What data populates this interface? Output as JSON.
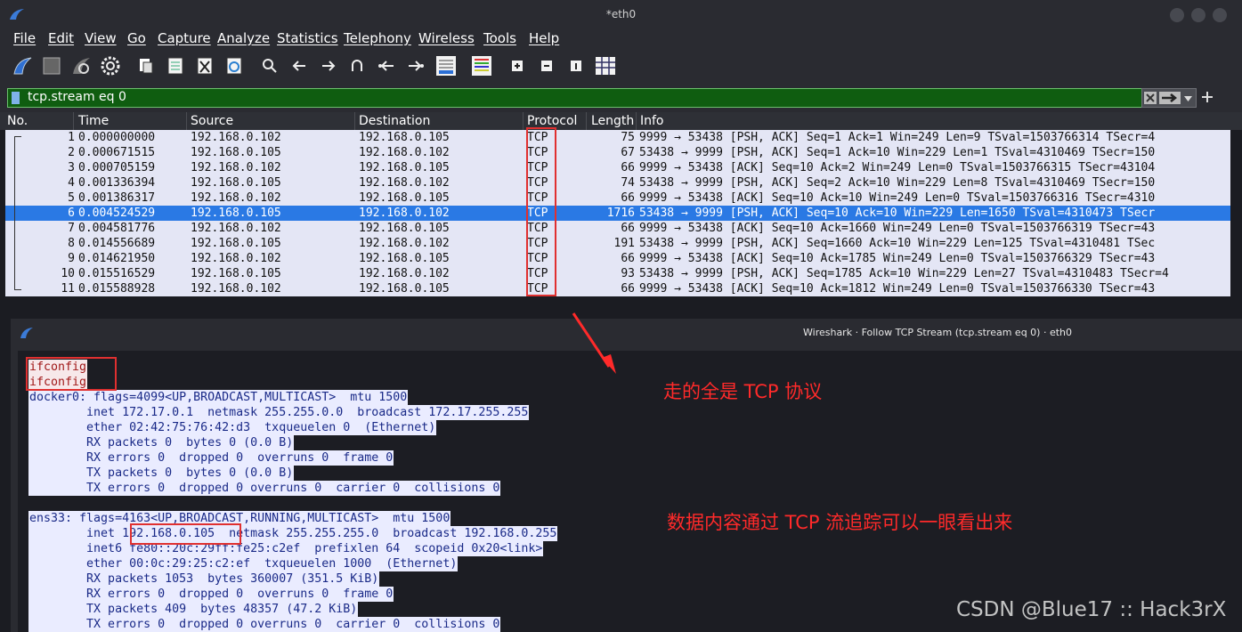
{
  "window": {
    "title": "*eth0"
  },
  "menu": [
    "File",
    "Edit",
    "View",
    "Go",
    "Capture",
    "Analyze",
    "Statistics",
    "Telephony",
    "Wireless",
    "Tools",
    "Help"
  ],
  "filter": {
    "value": "tcp.stream eq 0"
  },
  "columns": {
    "no": "No.",
    "time": "Time",
    "source": "Source",
    "destination": "Destination",
    "protocol": "Protocol",
    "length": "Length",
    "info": "Info"
  },
  "packets": [
    {
      "no": "1",
      "time": "0.000000000",
      "src": "192.168.0.102",
      "dst": "192.168.0.105",
      "proto": "TCP",
      "len": "75",
      "info": "9999 → 53438 [PSH, ACK] Seq=1 Ack=1 Win=249 Len=9 TSval=1503766314 TSecr=4"
    },
    {
      "no": "2",
      "time": "0.000671515",
      "src": "192.168.0.105",
      "dst": "192.168.0.102",
      "proto": "TCP",
      "len": "67",
      "info": "53438 → 9999 [PSH, ACK] Seq=1 Ack=10 Win=229 Len=1 TSval=4310469 TSecr=150"
    },
    {
      "no": "3",
      "time": "0.000705159",
      "src": "192.168.0.102",
      "dst": "192.168.0.105",
      "proto": "TCP",
      "len": "66",
      "info": "9999 → 53438 [ACK] Seq=10 Ack=2 Win=249 Len=0 TSval=1503766315 TSecr=43104"
    },
    {
      "no": "4",
      "time": "0.001336394",
      "src": "192.168.0.105",
      "dst": "192.168.0.102",
      "proto": "TCP",
      "len": "74",
      "info": "53438 → 9999 [PSH, ACK] Seq=2 Ack=10 Win=229 Len=8 TSval=4310469 TSecr=150"
    },
    {
      "no": "5",
      "time": "0.001386317",
      "src": "192.168.0.102",
      "dst": "192.168.0.105",
      "proto": "TCP",
      "len": "66",
      "info": "9999 → 53438 [ACK] Seq=10 Ack=10 Win=249 Len=0 TSval=1503766316 TSecr=4310"
    },
    {
      "no": "6",
      "time": "0.004524529",
      "src": "192.168.0.105",
      "dst": "192.168.0.102",
      "proto": "TCP",
      "len": "1716",
      "info": "53438 → 9999 [PSH, ACK] Seq=10 Ack=10 Win=229 Len=1650 TSval=4310473 TSecr"
    },
    {
      "no": "7",
      "time": "0.004581776",
      "src": "192.168.0.102",
      "dst": "192.168.0.105",
      "proto": "TCP",
      "len": "66",
      "info": "9999 → 53438 [ACK] Seq=10 Ack=1660 Win=249 Len=0 TSval=1503766319 TSecr=43"
    },
    {
      "no": "8",
      "time": "0.014556689",
      "src": "192.168.0.105",
      "dst": "192.168.0.102",
      "proto": "TCP",
      "len": "191",
      "info": "53438 → 9999 [PSH, ACK] Seq=1660 Ack=10 Win=229 Len=125 TSval=4310481 TSec"
    },
    {
      "no": "9",
      "time": "0.014621950",
      "src": "192.168.0.102",
      "dst": "192.168.0.105",
      "proto": "TCP",
      "len": "66",
      "info": "9999 → 53438 [ACK] Seq=10 Ack=1785 Win=249 Len=0 TSval=1503766329 TSecr=43"
    },
    {
      "no": "10",
      "time": "0.015516529",
      "src": "192.168.0.105",
      "dst": "192.168.0.102",
      "proto": "TCP",
      "len": "93",
      "info": "53438 → 9999 [PSH, ACK] Seq=1785 Ack=10 Win=229 Len=27 TSval=4310483 TSecr=4"
    },
    {
      "no": "11",
      "time": "0.015588928",
      "src": "192.168.0.102",
      "dst": "192.168.0.105",
      "proto": "TCP",
      "len": "66",
      "info": "9999 → 53438 [ACK] Seq=10 Ack=1812 Win=249 Len=0 TSval=1503766330 TSecr=43"
    }
  ],
  "follow": {
    "title": "Wireshark · Follow TCP Stream (tcp.stream eq 0) · eth0",
    "lines": [
      "ifconfig",
      "ifconfig",
      "docker0: flags=4099<UP,BROADCAST,MULTICAST>  mtu 1500",
      "        inet 172.17.0.1  netmask 255.255.0.0  broadcast 172.17.255.255",
      "        ether 02:42:75:76:42:d3  txqueuelen 0  (Ethernet)",
      "        RX packets 0  bytes 0 (0.0 B)",
      "        RX errors 0  dropped 0  overruns 0  frame 0",
      "        TX packets 0  bytes 0 (0.0 B)",
      "        TX errors 0  dropped 0 overruns 0  carrier 0  collisions 0",
      "",
      "ens33: flags=4163<UP,BROADCAST,RUNNING,MULTICAST>  mtu 1500",
      "        inet 192.168.0.105  netmask 255.255.255.0  broadcast 192.168.0.255",
      "        inet6 fe80::20c:29ff:fe25:c2ef  prefixlen 64  scopeid 0x20<link>",
      "        ether 00:0c:29:25:c2:ef  txqueuelen 1000  (Ethernet)",
      "        RX packets 1053  bytes 360007 (351.5 KiB)",
      "        RX errors 0  dropped 0  overruns 0  frame 0",
      "        TX packets 409  bytes 48357 (47.2 KiB)",
      "        TX errors 0  dropped 0 overruns 0  carrier 0  collisions 0"
    ]
  },
  "annotations": {
    "a1": "走的全是 TCP 协议",
    "a2": "数据内容通过 TCP 流追踪可以一眼看出来"
  },
  "watermark": "CSDN @Blue17 :: Hack3rX",
  "colors": {
    "selected_row": "#2a79e4",
    "filter_bg": "#0f5d10",
    "highlight_box": "#e03030",
    "annotation": "#ff2a2a"
  }
}
